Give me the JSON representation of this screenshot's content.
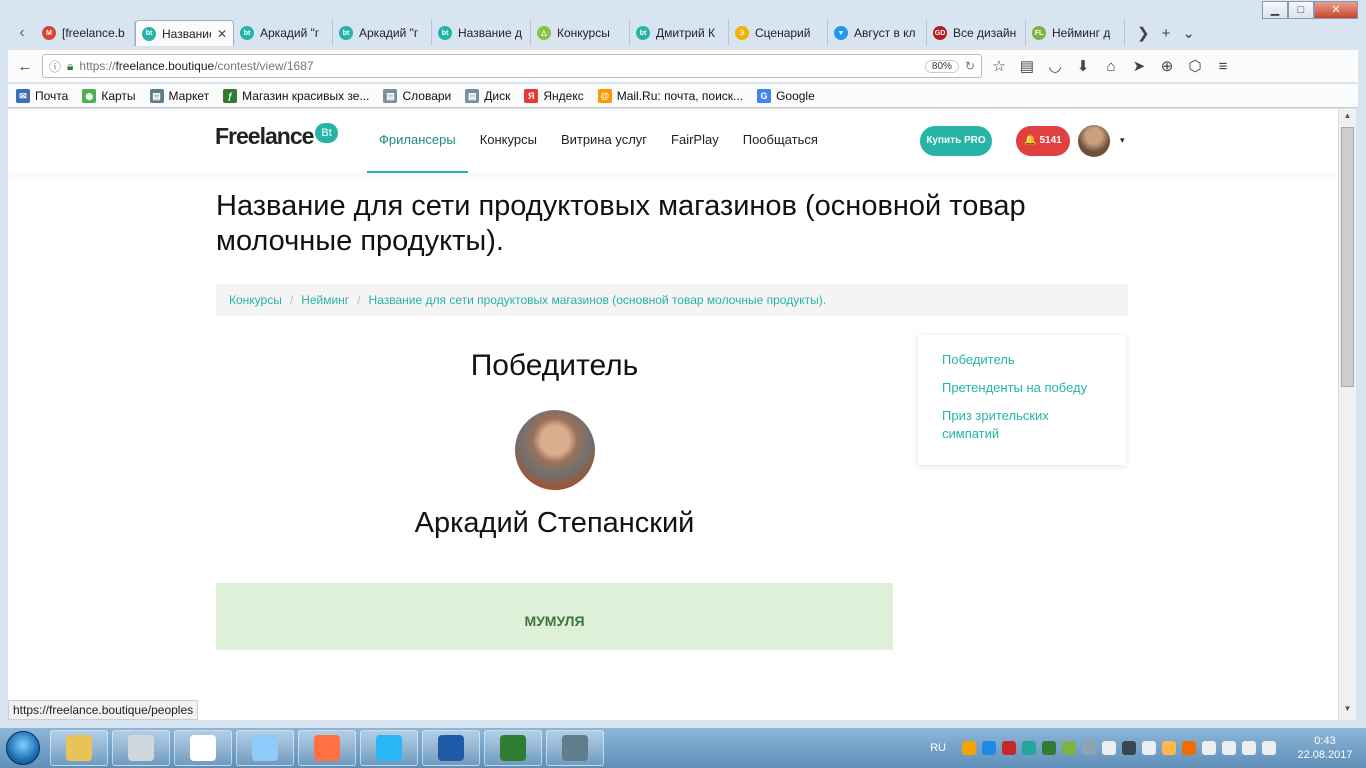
{
  "window_controls": {
    "minimize": "▁",
    "maximize": "□",
    "close": "✕"
  },
  "tabs": [
    {
      "label": "[freelance.b",
      "fav_text": "M",
      "fav_color": "#d44638",
      "active": false
    },
    {
      "label": "Название",
      "fav_text": "bt",
      "fav_color": "#25b4a6",
      "active": true
    },
    {
      "label": "Аркадий \"г",
      "fav_text": "bt",
      "fav_color": "#25b4a6",
      "active": false
    },
    {
      "label": "Аркадий \"г",
      "fav_text": "bt",
      "fav_color": "#25b4a6",
      "active": false
    },
    {
      "label": "Название д",
      "fav_text": "bt",
      "fav_color": "#25b4a6",
      "active": false
    },
    {
      "label": "Конкурсы",
      "fav_text": "△",
      "fav_color": "#8bc34a",
      "active": false
    },
    {
      "label": "Дмитрий К",
      "fav_text": "bt",
      "fav_color": "#25b4a6",
      "active": false
    },
    {
      "label": "Сценарий",
      "fav_text": "Э",
      "fav_color": "#f0b400",
      "active": false
    },
    {
      "label": "Август в кл",
      "fav_text": "▼",
      "fav_color": "#2196f3",
      "active": false
    },
    {
      "label": "Все дизайн",
      "fav_text": "GD",
      "fav_color": "#b71c1c",
      "active": false
    },
    {
      "label": "Нейминг д",
      "fav_text": "FL",
      "fav_color": "#7cb342",
      "active": false
    }
  ],
  "tab_close_glyph": "✕",
  "tab_tools": {
    "scroll": "❯",
    "new_tab": "+",
    "list": "⌄"
  },
  "nav": {
    "url_prefix": "https://",
    "url_domain": "freelance.boutique",
    "url_path": "/contest/view/1687",
    "zoom": "80%",
    "icons": [
      "back-icon",
      "star-icon",
      "reader-icon",
      "pocket-icon",
      "download-icon",
      "home-icon",
      "send-icon",
      "globe-icon",
      "extension-icon",
      "menu-icon"
    ]
  },
  "bookmarks": [
    {
      "label": "Почта",
      "color": "#3b6fb6",
      "glyph": "✉"
    },
    {
      "label": "Карты",
      "color": "#4caf50",
      "glyph": "◉"
    },
    {
      "label": "Маркет",
      "color": "#607d8b",
      "glyph": "▤"
    },
    {
      "label": "Магазин красивых зе...",
      "color": "#2e7d32",
      "glyph": "ƒ"
    },
    {
      "label": "Словари",
      "color": "#78909c",
      "glyph": "▤"
    },
    {
      "label": "Диск",
      "color": "#78909c",
      "glyph": "▤"
    },
    {
      "label": "Яндекс",
      "color": "#e53935",
      "glyph": "Я"
    },
    {
      "label": "Mail.Ru: почта, поиск...",
      "color": "#ff9800",
      "glyph": "@"
    },
    {
      "label": "Google",
      "color": "#4285f4",
      "glyph": "G"
    }
  ],
  "site": {
    "logo_text": "Freelance",
    "logo_badge": "Bt",
    "menu": [
      "Фрилансеры",
      "Конкурсы",
      "Витрина услуг",
      "FairPlay",
      "Пообщаться"
    ],
    "buy_pro": "Купить PRO",
    "notifications": "🔔 5141",
    "caret": "▾"
  },
  "page": {
    "title": "Название для сети продуктовых магазинов (основной товар молочные продукты).",
    "breadcrumbs": [
      "Конкурсы",
      "Нейминг",
      "Название для сети продуктовых магазинов (основной товар молочные продукты)."
    ],
    "breadcrumb_sep": "/",
    "winner_heading": "Победитель",
    "winner_name": "Аркадий Степанский",
    "winning_name": "МУМУЛЯ",
    "sidebar": [
      "Победитель",
      "Претенденты на победу",
      "Приз зрительских симпатий"
    ]
  },
  "status_url": "https://freelance.boutique/peoples",
  "taskbar": {
    "apps": [
      {
        "name": "explorer",
        "color": "#e8c35a"
      },
      {
        "name": "calculator",
        "color": "#cfd8dc"
      },
      {
        "name": "font-viewer",
        "color": "#ffffff"
      },
      {
        "name": "notepad",
        "color": "#90caf9"
      },
      {
        "name": "firefox",
        "color": "#ff7043"
      },
      {
        "name": "skype",
        "color": "#29b6f6"
      },
      {
        "name": "word",
        "color": "#1e5aa8"
      },
      {
        "name": "excel",
        "color": "#2e7d32"
      },
      {
        "name": "task-manager",
        "color": "#607d8b"
      }
    ],
    "lang": "RU",
    "time": "0:43",
    "date": "22.08.2017"
  }
}
